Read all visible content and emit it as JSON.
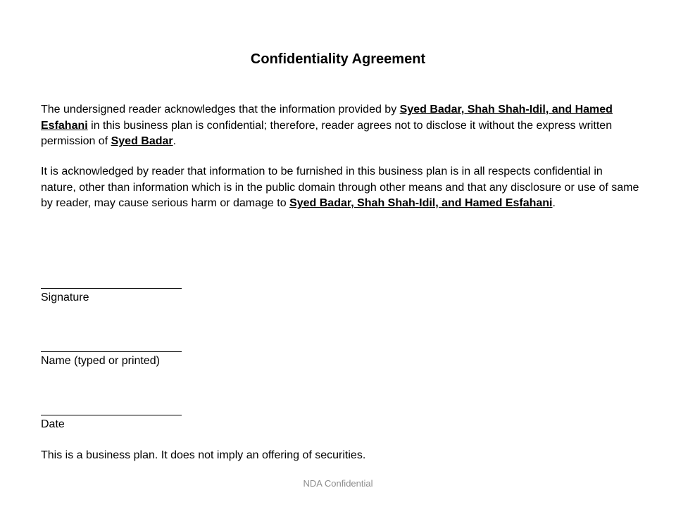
{
  "document": {
    "title": "Confidentiality Agreement",
    "paragraph1": {
      "text_a": "The undersigned reader acknowledges that the information provided by ",
      "party_a": "Syed Badar, Shah Shah-Idil, and Hamed Esfahani",
      "text_b": " in this business plan is confidential; therefore, reader agrees not to disclose it without the express written permission of ",
      "party_b": "Syed Badar",
      "text_c": "."
    },
    "paragraph2": {
      "text_a": "It is acknowledged by reader that information to be furnished in this business plan is in all respects confidential in nature, other than information which is in the public domain through other means and that any disclosure or use of same by reader, may cause serious harm or damage to ",
      "party_a": "Syed Badar, Shah Shah-Idil, and Hamed Esfahani",
      "text_b": "."
    },
    "signature_fields": [
      {
        "label": "Signature"
      },
      {
        "label": "Name (typed or printed)"
      },
      {
        "label": "Date"
      }
    ],
    "disclaimer": "This is a business plan.  It does not imply an offering of securities.",
    "footer": "NDA Confidential"
  }
}
